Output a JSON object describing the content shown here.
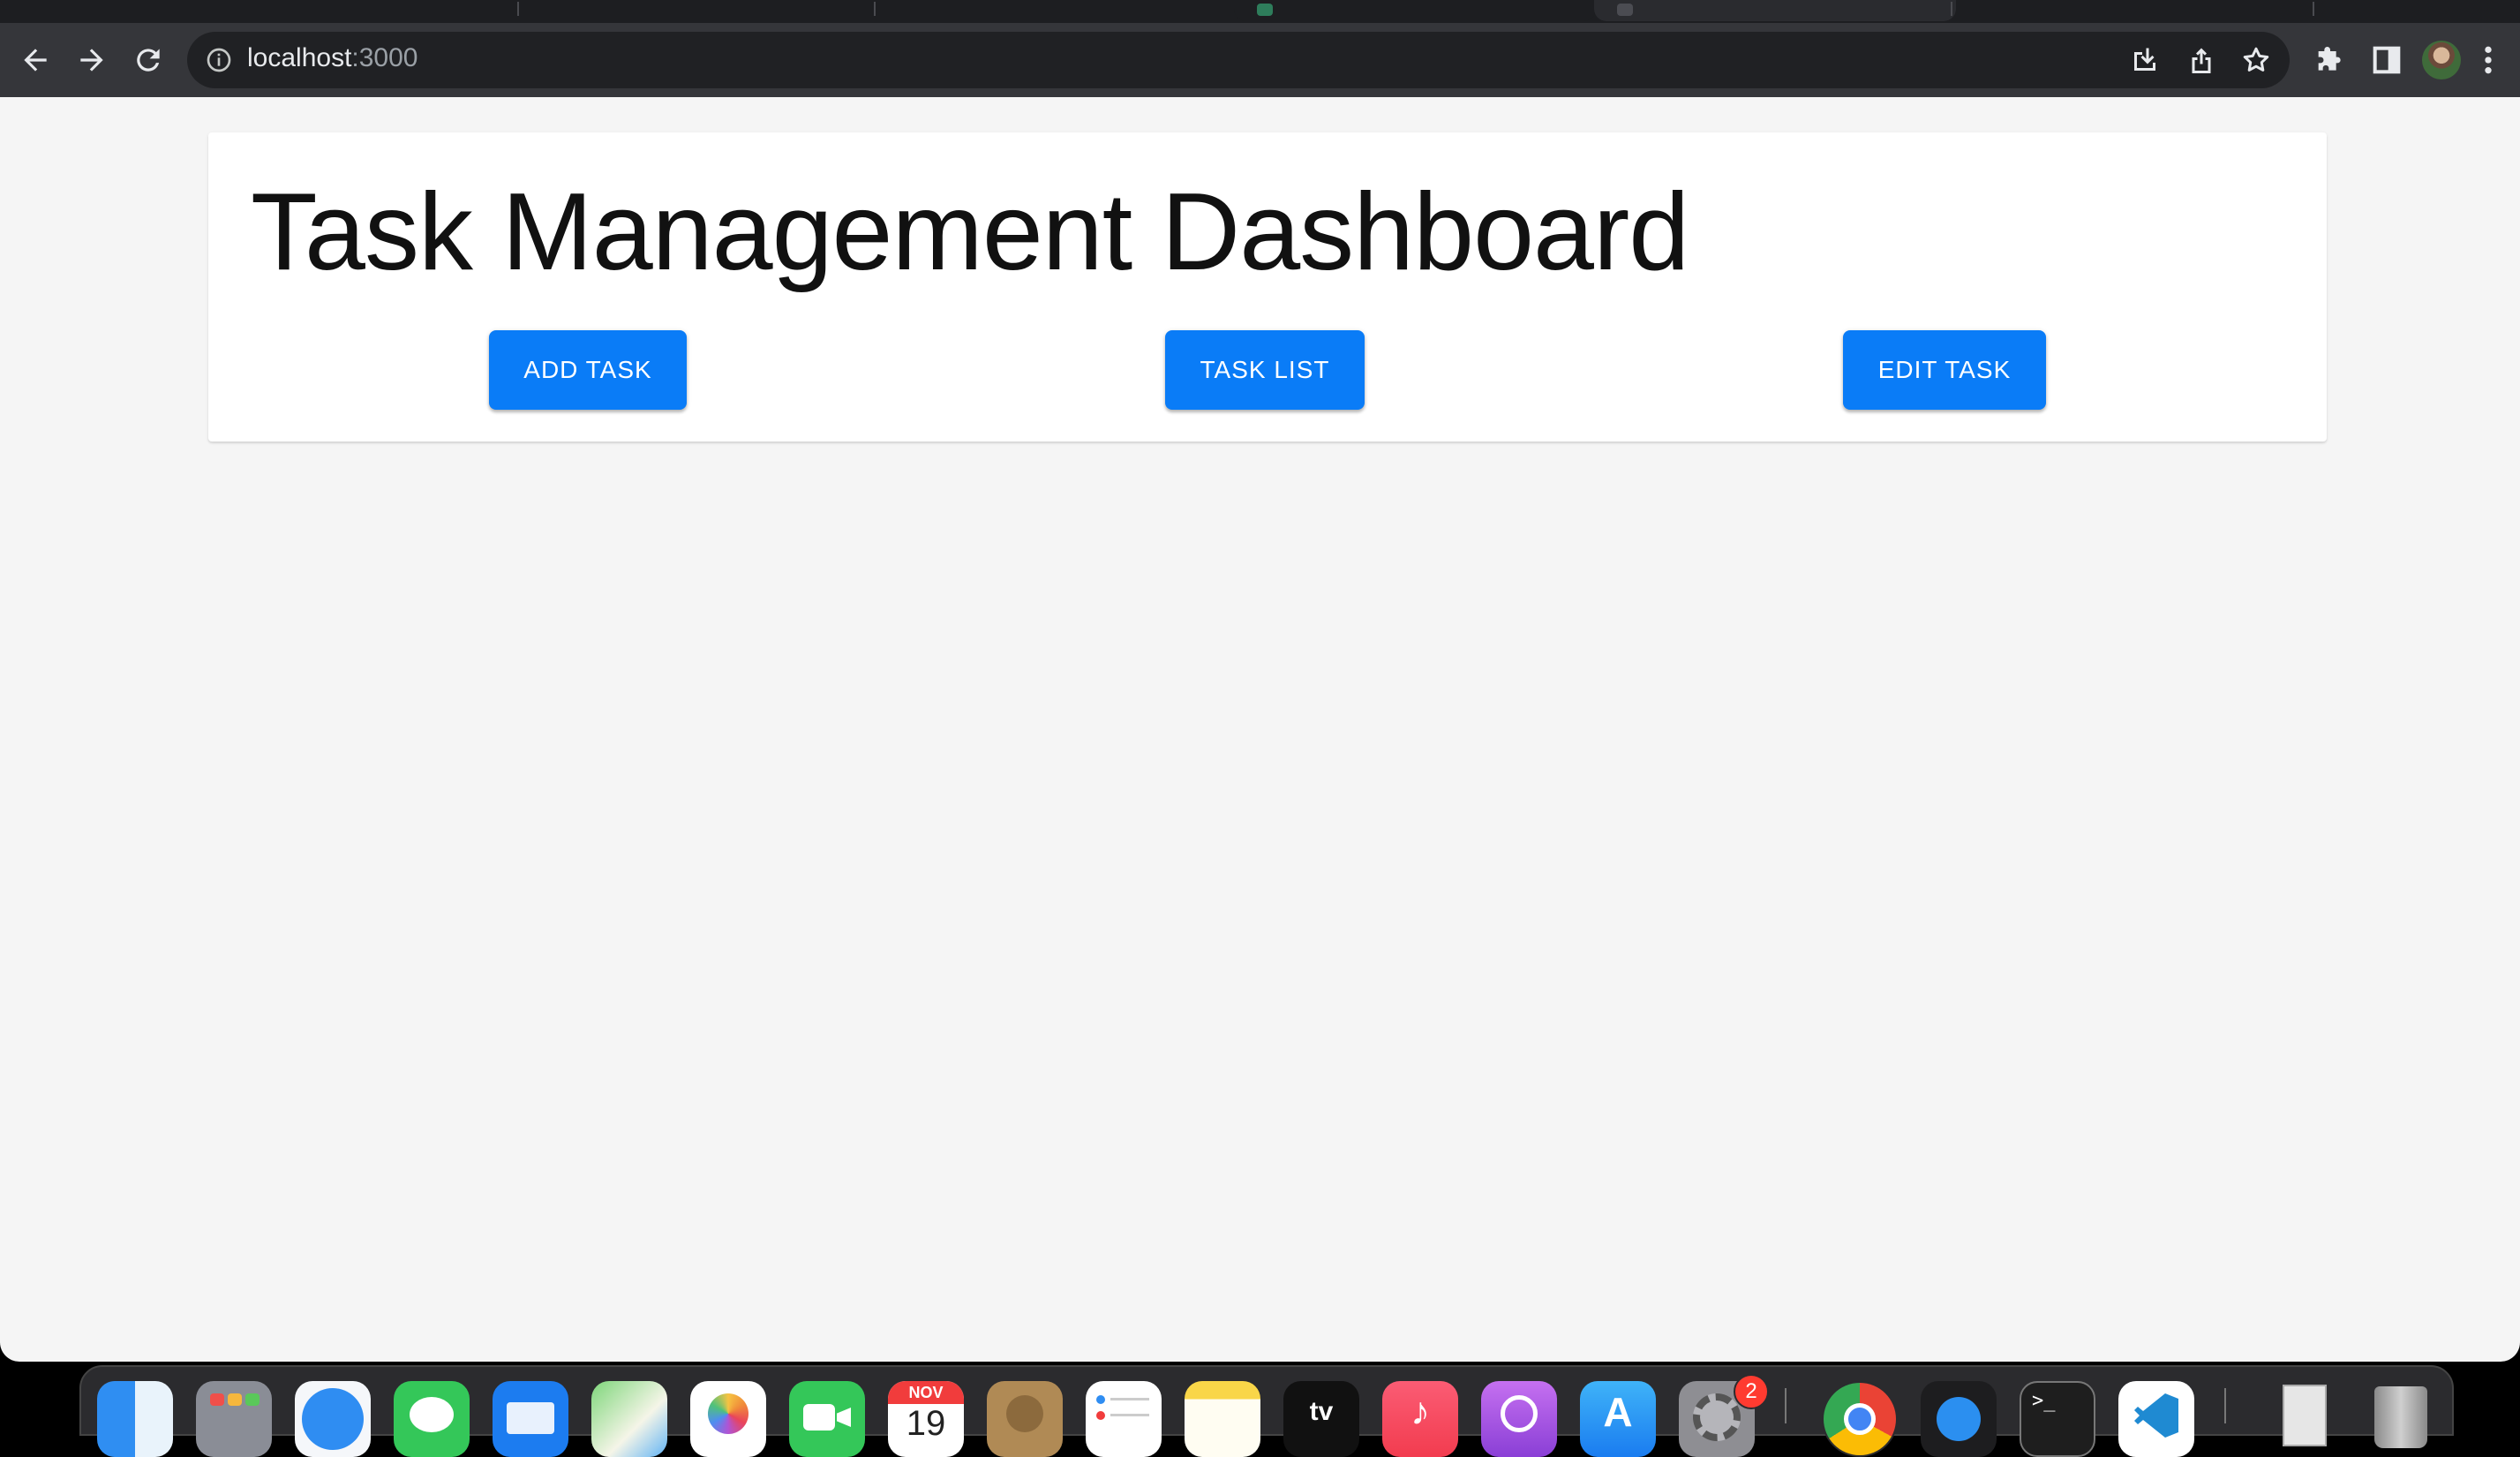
{
  "browser": {
    "url_host": "localhost",
    "url_port": ":3000"
  },
  "page": {
    "title": "Task Management Dashboard",
    "buttons": {
      "add_task": "ADD TASK",
      "task_list": "TASK LIST",
      "edit_task": "EDIT TASK"
    },
    "accent_color": "#0a7cf7"
  },
  "dock": {
    "calendar_month": "NOV",
    "calendar_day": "19",
    "settings_badge": "2",
    "icons": [
      "finder-icon",
      "launchpad-icon",
      "safari-icon",
      "messages-icon",
      "mail-icon",
      "maps-icon",
      "photos-icon",
      "facetime-icon",
      "calendar-icon",
      "contacts-icon",
      "reminders-icon",
      "notes-icon",
      "apple-tv-icon",
      "music-icon",
      "podcasts-icon",
      "app-store-icon",
      "system-settings-icon",
      "chrome-icon",
      "proxyman-icon",
      "terminal-icon",
      "vscode-icon",
      "documents-stack-icon",
      "trash-icon"
    ]
  }
}
